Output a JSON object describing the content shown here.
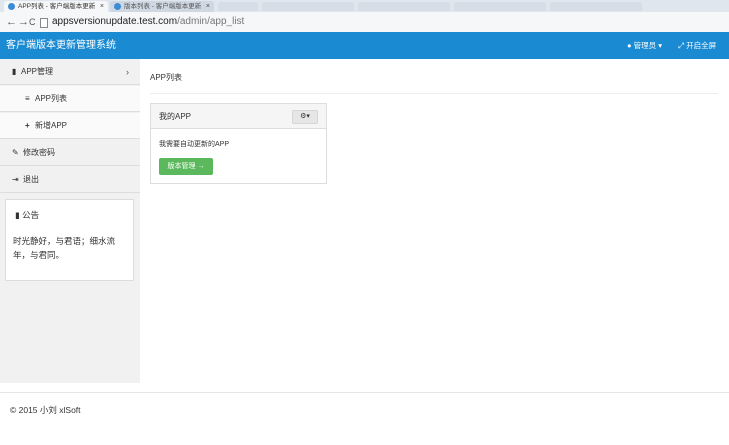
{
  "browser": {
    "tabs": [
      {
        "title": "APP列表 - 客户端版本更新",
        "close": "×"
      },
      {
        "title": "版本列表 - 客户端版本更新",
        "close": "×"
      }
    ],
    "url_host": "appsversionupdate.test.com",
    "url_path": "/admin/app_list",
    "back": "←",
    "forward": "→",
    "reload": "C"
  },
  "navbar": {
    "brand": "客户端版本更新管理系统",
    "user_label": "管理员",
    "fullscreen_label": "开启全屏",
    "bg": "#1a8bd2"
  },
  "sidebar": {
    "app_manage": "APP管理",
    "app_list": "APP列表",
    "add_app": "新增APP",
    "change_password": "修改密码",
    "logout": "退出",
    "notice_title": "公告",
    "notice_body": "时光静好，与君语；细水流年，与君同。"
  },
  "main": {
    "page_title": "APP列表",
    "panel_title": "我的APP",
    "panel_desc": "我需要自动更新的APP",
    "version_button": "版本管理 →",
    "button_color": "#5cb85c"
  },
  "footer": {
    "text": "© 2015 小刘 xlSoft"
  }
}
